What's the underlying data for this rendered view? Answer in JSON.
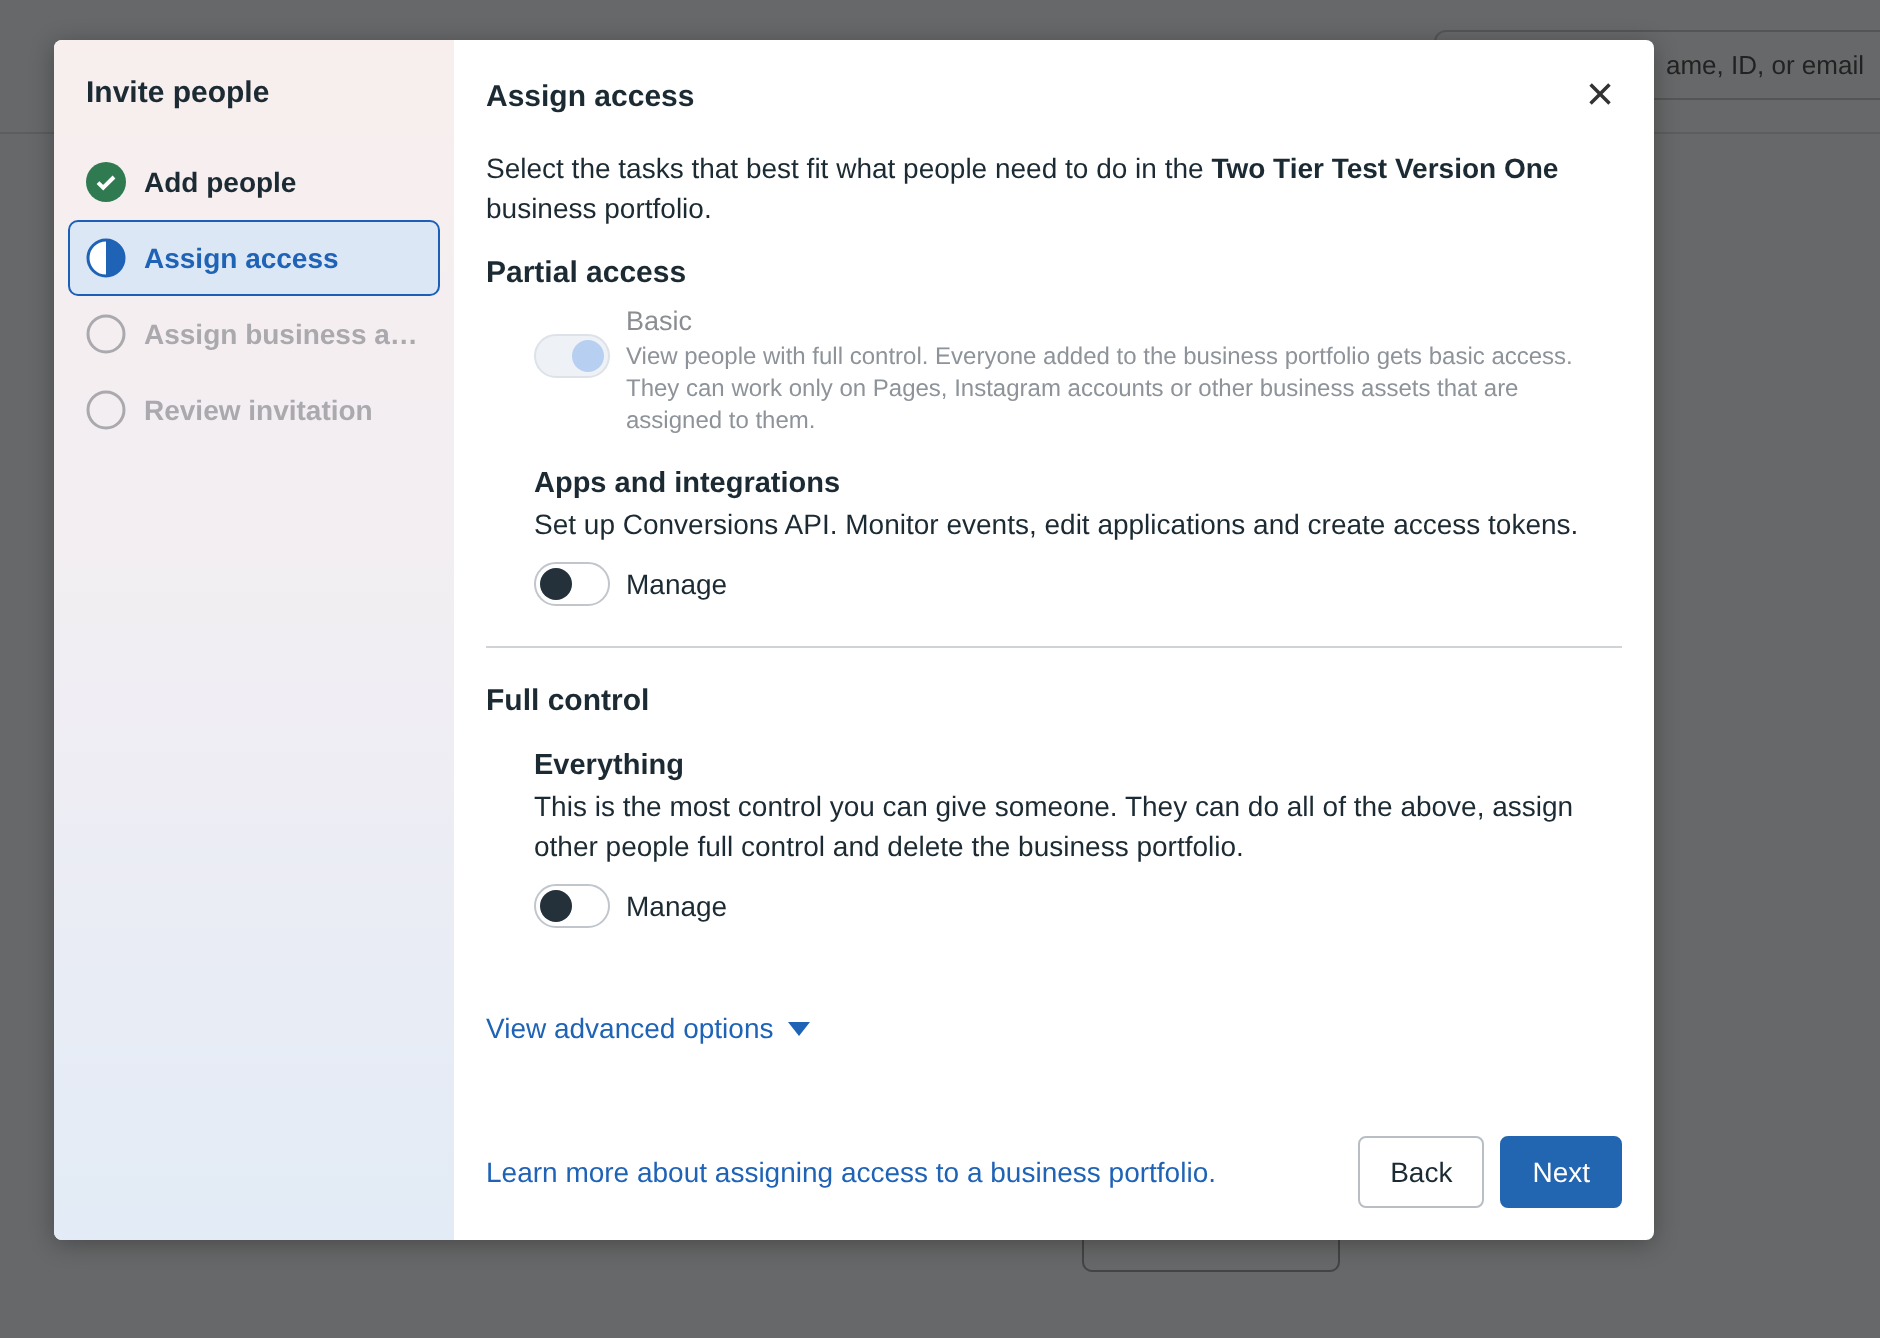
{
  "background": {
    "search": {
      "placeholder": "ame, ID, or email"
    }
  },
  "sidebar": {
    "title": "Invite people",
    "steps": [
      {
        "label": "Add people",
        "completed": true,
        "selected": false
      },
      {
        "label": "Assign access",
        "completed": false,
        "selected": true
      },
      {
        "label": "Assign business a…",
        "completed": false,
        "selected": false
      },
      {
        "label": "Review invitation",
        "completed": false,
        "selected": false
      }
    ]
  },
  "dialog": {
    "title": "Assign access",
    "close": "×",
    "intro": "Select the tasks that best fit what people need to do in the **Two Tier Test Version One** business portfolio.",
    "sections": [
      {
        "heading": "Partial access",
        "items": [
          {
            "kind": "inline",
            "title": "Basic",
            "description": "View people with full control. Everyone added to the business portfolio gets basic access. They can work only on Pages, Instagram accounts or other business assets that are assigned to them.",
            "on": true,
            "disabled": true
          },
          {
            "kind": "stacked",
            "title": "Apps and integrations",
            "description": "Set up Conversions API. Monitor events, edit applications and create access tokens.",
            "toggle_label": "Manage",
            "on": false,
            "disabled": false
          }
        ]
      },
      {
        "heading": "Full control",
        "items": [
          {
            "kind": "stacked",
            "title": "Everything",
            "description": "This is the most control you can give someone. They can do all of the above, assign other people full control and delete the business portfolio.",
            "toggle_label": "Manage",
            "on": false,
            "disabled": false
          }
        ]
      }
    ],
    "advanced": "View advanced options",
    "learn_more": "Learn more about assigning access to a business portfolio.",
    "buttons": [
      {
        "label": "Back",
        "kind": "secondary"
      },
      {
        "label": "Next",
        "kind": "primary"
      }
    ]
  }
}
